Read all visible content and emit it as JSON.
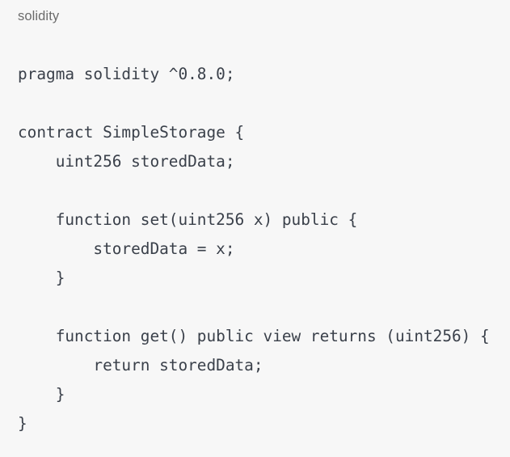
{
  "block": {
    "language_label": "solidity",
    "background_color": "#f7f7f7",
    "code_color": "#3a404a",
    "label_color": "#6b6b6b"
  },
  "code": {
    "full_text": "pragma solidity ^0.8.0;\n\ncontract SimpleStorage {\n    uint256 storedData;\n\n    function set(uint256 x) public {\n        storedData = x;\n    }\n\n    function get() public view returns (uint256) {\n        return storedData;\n    }\n}",
    "lines": [
      "pragma solidity ^0.8.0;",
      "",
      "contract SimpleStorage {",
      "    uint256 storedData;",
      "",
      "    function set(uint256 x) public {",
      "        storedData = x;",
      "    }",
      "",
      "    function get() public view returns (uint256) {",
      "        return storedData;",
      "    }",
      "}"
    ]
  }
}
